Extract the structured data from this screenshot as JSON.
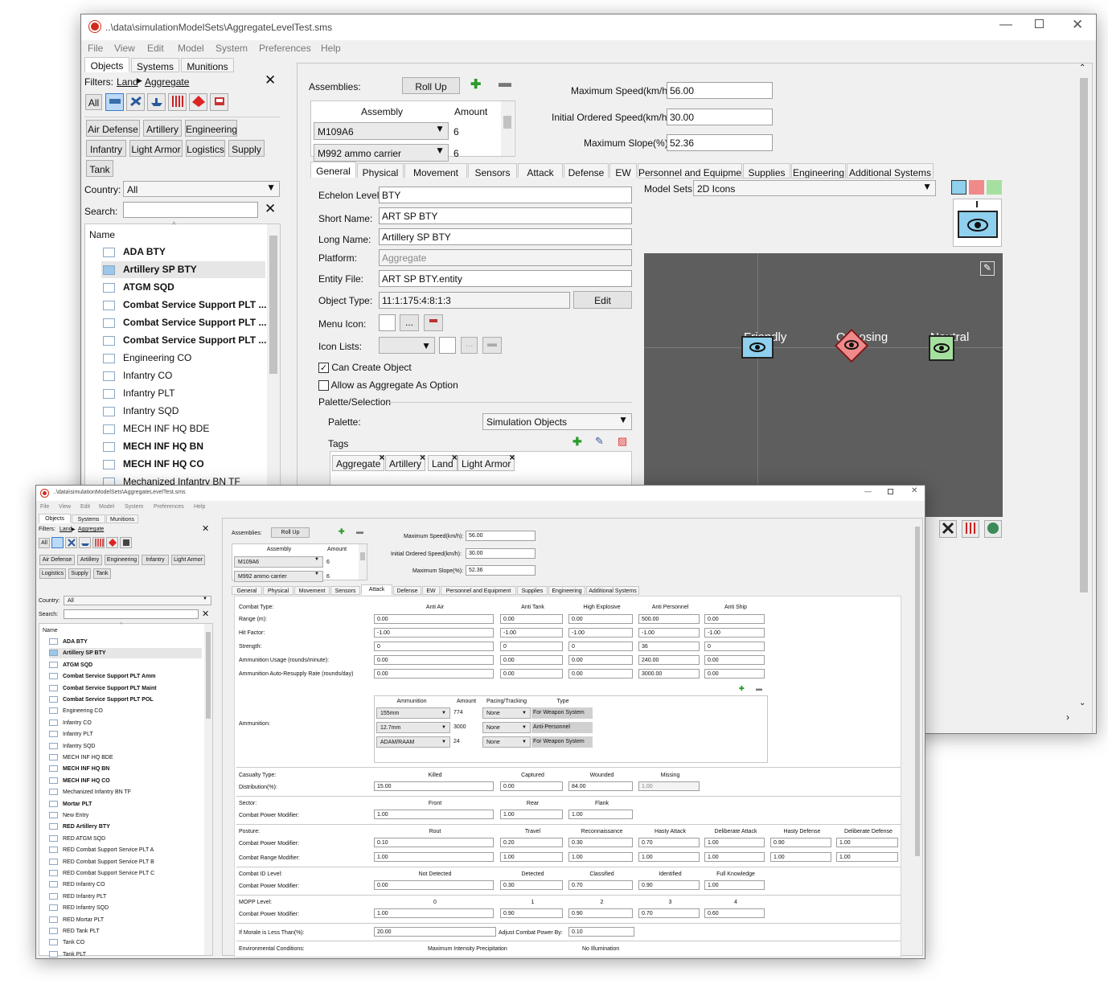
{
  "back": {
    "title": "..\\data\\simulationModelSets\\AggregateLevelTest.sms",
    "menu": [
      "File",
      "View",
      "Edit",
      "Model",
      "System",
      "Preferences",
      "Help"
    ],
    "left_tabs": [
      "Objects",
      "Systems",
      "Munitions"
    ],
    "filters_label": "Filters:",
    "crumb_land": "Land",
    "crumb_aggregate": "Aggregate",
    "all_label": "All",
    "categories": [
      "Air Defense",
      "Artillery",
      "Engineering",
      "Infantry",
      "Light Armor",
      "Logistics",
      "Supply",
      "Tank"
    ],
    "country_label": "Country:",
    "country_value": "All",
    "search_label": "Search:",
    "search_value": "",
    "name_header": "Name",
    "objects": [
      {
        "name": "ADA BTY",
        "bold": true
      },
      {
        "name": "Artillery SP BTY",
        "bold": true,
        "selected": true
      },
      {
        "name": "ATGM SQD",
        "bold": true
      },
      {
        "name": "Combat Service Support PLT ...",
        "bold": true
      },
      {
        "name": "Combat Service Support PLT ...",
        "bold": true
      },
      {
        "name": "Combat Service Support PLT ...",
        "bold": true
      },
      {
        "name": "Engineering CO",
        "bold": false
      },
      {
        "name": "Infantry CO",
        "bold": false
      },
      {
        "name": "Infantry PLT",
        "bold": false
      },
      {
        "name": "Infantry SQD",
        "bold": false
      },
      {
        "name": "MECH INF HQ BDE",
        "bold": false
      },
      {
        "name": "MECH INF HQ BN",
        "bold": true
      },
      {
        "name": "MECH INF HQ CO",
        "bold": true
      },
      {
        "name": "Mechanized Infantry BN TF",
        "bold": false
      }
    ],
    "assemblies_label": "Assemblies:",
    "rollup_label": "Roll Up",
    "assembly_header": "Assembly",
    "amount_header": "Amount",
    "assemblies": [
      {
        "name": "M109A6",
        "amount": "6"
      },
      {
        "name": "M992 ammo carrier",
        "amount": "6"
      }
    ],
    "max_speed_label": "Maximum Speed(km/h):",
    "max_speed": "56.00",
    "init_speed_label": "Initial Ordered Speed(km/h):",
    "init_speed": "30.00",
    "max_slope_label": "Maximum Slope(%):",
    "max_slope": "52.36",
    "tabs": [
      "General",
      "Physical",
      "Movement",
      "Sensors",
      "Attack",
      "Defense",
      "EW",
      "Personnel and Equipment",
      "Supplies",
      "Engineering",
      "Additional Systems"
    ],
    "general": {
      "echelon_label": "Echelon Level:",
      "echelon": "BTY",
      "short_label": "Short Name:",
      "short": "ART SP BTY",
      "long_label": "Long Name:",
      "long": "Artillery SP BTY",
      "platform_label": "Platform:",
      "platform": "Aggregate",
      "entity_label": "Entity File:",
      "entity": "ART SP BTY.entity",
      "objtype_label": "Object Type:",
      "objtype": "11:1:175:4:8:1:3",
      "edit_label": "Edit",
      "menuicon_label": "Menu Icon:",
      "iconlists_label": "Icon Lists:",
      "dots": "...",
      "can_create": "Can Create Object",
      "allow_agg": "Allow as Aggregate As Option",
      "palette_section": "Palette/Selection",
      "palette_label": "Palette:",
      "palette": "Simulation Objects",
      "tags_label": "Tags",
      "tags": [
        "Aggregate",
        "Artillery",
        "Land",
        "Light Armor"
      ]
    },
    "model_sets_label": "Model Sets:",
    "model_sets": "2D Icons",
    "preview_labels": [
      "Friendly",
      "Opposing",
      "Neutral"
    ],
    "colors": {
      "friendly": "#8ed0ee",
      "opposing": "#f08a8a",
      "neutral": "#a6e0a0",
      "preview_bg": "#5e5e5e"
    }
  },
  "front": {
    "title": "..\\data\\simulationModelSets\\AggregateLevelTest.sms",
    "menu": [
      "File",
      "View",
      "Edit",
      "Model",
      "System",
      "Preferences",
      "Help"
    ],
    "left_tabs": [
      "Objects",
      "Systems",
      "Munitions"
    ],
    "filters_label": "Filters:",
    "crumb_land": "Land",
    "crumb_aggregate": "Aggregate",
    "all_label": "All",
    "categories": [
      "Air Defense",
      "Artillery",
      "Engineering",
      "Infantry",
      "Light Armor",
      "Logistics",
      "Supply",
      "Tank"
    ],
    "country_label": "Country:",
    "country_value": "All",
    "search_label": "Search:",
    "name_header": "Name",
    "objects": [
      {
        "name": "ADA BTY",
        "bold": true
      },
      {
        "name": "Artillery SP BTY",
        "bold": true,
        "selected": true
      },
      {
        "name": "ATGM SQD",
        "bold": true
      },
      {
        "name": "Combat Service Support PLT Amm",
        "bold": true
      },
      {
        "name": "Combat Service Support PLT Maint",
        "bold": true
      },
      {
        "name": "Combat Service Support PLT POL",
        "bold": true
      },
      {
        "name": "Engineering CO",
        "bold": false
      },
      {
        "name": "Infantry CO",
        "bold": false
      },
      {
        "name": "Infantry PLT",
        "bold": false
      },
      {
        "name": "Infantry SQD",
        "bold": false
      },
      {
        "name": "MECH INF HQ BDE",
        "bold": false
      },
      {
        "name": "MECH INF HQ BN",
        "bold": true
      },
      {
        "name": "MECH INF HQ CO",
        "bold": true
      },
      {
        "name": "Mechanized Infantry BN TF",
        "bold": false
      },
      {
        "name": "Mortar PLT",
        "bold": true
      },
      {
        "name": "New Entry",
        "bold": false
      },
      {
        "name": "RED Artillery BTY",
        "bold": true
      },
      {
        "name": "RED ATGM SQD",
        "bold": false
      },
      {
        "name": "RED Combat Support Service PLT A",
        "bold": false
      },
      {
        "name": "RED Combat Support Service PLT B",
        "bold": false
      },
      {
        "name": "RED Combat Support Service PLT C",
        "bold": false
      },
      {
        "name": "RED Infantry CO",
        "bold": false
      },
      {
        "name": "RED Infantry PLT",
        "bold": false
      },
      {
        "name": "RED Infantry SQD",
        "bold": false
      },
      {
        "name": "RED Mortar PLT",
        "bold": false
      },
      {
        "name": "RED Tank PLT",
        "bold": false
      },
      {
        "name": "Tank CO",
        "bold": false
      },
      {
        "name": "Tank PLT",
        "bold": false
      }
    ],
    "assemblies_label": "Assemblies:",
    "rollup_label": "Roll Up",
    "assembly_header": "Assembly",
    "amount_header": "Amount",
    "assemblies": [
      {
        "name": "M109A6",
        "amount": "6"
      },
      {
        "name": "M992 ammo carrier",
        "amount": "6"
      }
    ],
    "max_speed_label": "Maximum Speed(km/h):",
    "max_speed": "56.00",
    "init_speed_label": "Initial Ordered Speed(km/h):",
    "init_speed": "30.00",
    "max_slope_label": "Maximum Slope(%):",
    "max_slope": "52.36",
    "tabs": [
      "General",
      "Physical",
      "Movement",
      "Sensors",
      "Attack",
      "Defense",
      "EW",
      "Personnel and Equipment",
      "Supplies",
      "Engineering",
      "Additional Systems"
    ],
    "attack": {
      "combat_type_label": "Combat Type:",
      "combat_types": [
        "Anti Air",
        "Anti Tank",
        "High Explosive",
        "Anti Personnel",
        "Anti Ship"
      ],
      "rows": [
        {
          "label": "Range (m):",
          "values": [
            "0.00",
            "0.00",
            "0.00",
            "500.00",
            "0.00"
          ]
        },
        {
          "label": "Hit Factor:",
          "values": [
            "-1.00",
            "-1.00",
            "-1.00",
            "-1.00",
            "-1.00"
          ]
        },
        {
          "label": "Strength:",
          "values": [
            "0",
            "0",
            "0",
            "36",
            "0"
          ]
        },
        {
          "label": "Ammunition Usage (rounds/minute):",
          "values": [
            "0.00",
            "0.00",
            "0.00",
            "240.00",
            "0.00"
          ]
        },
        {
          "label": "Ammunition Auto-Resupply Rate (rounds/day)",
          "values": [
            "0.00",
            "0.00",
            "0.00",
            "3000.00",
            "0.00"
          ]
        }
      ],
      "ammunition_label": "Ammunition:",
      "ammo_headers": [
        "Ammunition",
        "Amount",
        "Pacing/Tracking",
        "Type"
      ],
      "ammo": [
        {
          "name": "155mm",
          "amount": "774",
          "pacing": "None",
          "type": "For Weapon System"
        },
        {
          "name": "12.7mm",
          "amount": "3000",
          "pacing": "None",
          "type": "Anti-Personnel"
        },
        {
          "name": "ADAM/RAAM",
          "amount": "24",
          "pacing": "None",
          "type": "For Weapon System"
        }
      ],
      "casualty_label": "Casualty Type:",
      "casualty_types": [
        "Killed",
        "Captured",
        "Wounded",
        "Missing"
      ],
      "distribution_label": "Distribution(%):",
      "distribution": [
        "15.00",
        "0.00",
        "84.00",
        "1.00"
      ],
      "sector_label": "Sector:",
      "sectors": [
        "Front",
        "Rear",
        "Flank"
      ],
      "cpm_label": "Combat Power Modifier:",
      "sector_values": [
        "1.00",
        "1.00",
        "1.00"
      ],
      "posture_label": "Posture:",
      "postures": [
        "Rout",
        "Travel",
        "Reconnaissance",
        "Hasty Attack",
        "Deliberate Attack",
        "Hasty Defense",
        "Deliberate Defense"
      ],
      "posture_cpm": [
        "0.10",
        "0.20",
        "0.30",
        "0.70",
        "1.00",
        "0.90",
        "1.00"
      ],
      "crm_label": "Combat Range Modifier:",
      "posture_crm": [
        "1.00",
        "1.00",
        "1.00",
        "1.00",
        "1.00",
        "1.00",
        "1.00"
      ],
      "combat_id_label": "Combat ID Level:",
      "combat_ids": [
        "Not Detected",
        "Detected",
        "Classified",
        "Identified",
        "Full Knowledge"
      ],
      "combat_id_values": [
        "0.00",
        "0.30",
        "0.70",
        "0.90",
        "1.00"
      ],
      "mopp_label": "MOPP Level:",
      "mopp_levels": [
        "0",
        "1",
        "2",
        "3",
        "4"
      ],
      "mopp_values": [
        "1.00",
        "0.90",
        "0.90",
        "0.70",
        "0.60"
      ],
      "morale_label": "If Morale is Less Than(%):",
      "morale": "20.00",
      "adjust_label": "Adjust Combat Power By:",
      "adjust": "0.10",
      "env_label": "Environmental Conditions:",
      "env_values": [
        "Maximum Intensity Precipitation",
        "No Illumination"
      ]
    }
  }
}
